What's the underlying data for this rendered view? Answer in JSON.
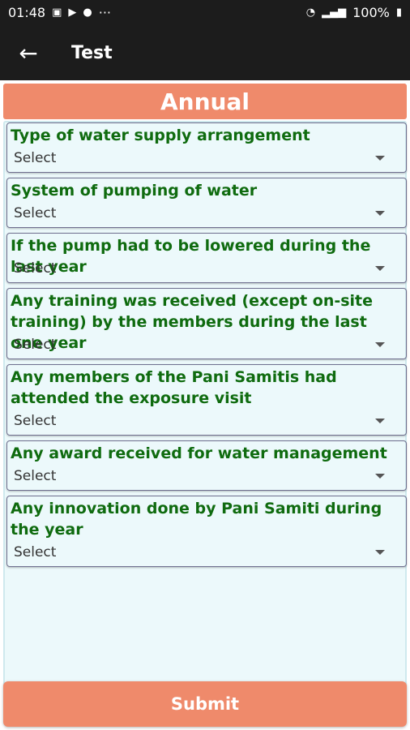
{
  "status_bar": {
    "time": "01:48",
    "battery": "100%",
    "more": "···"
  },
  "app_bar": {
    "back_icon": "arrow-left",
    "title": "Test"
  },
  "section": {
    "title": "Annual"
  },
  "fields": [
    {
      "label": "Type of water supply arrangement",
      "value": "Select"
    },
    {
      "label": "System of pumping of water",
      "value": "Select"
    },
    {
      "label": "If the pump had to be lowered during the last year",
      "value": "Select"
    },
    {
      "label": "Any training was received (except on-site training) by the members during the last one year",
      "value": "Select"
    },
    {
      "label": "Any members of the Pani Samitis had attended the exposure visit",
      "value": "Select"
    },
    {
      "label": "Any award received for water management",
      "value": "Select"
    },
    {
      "label": "Any innovation done by Pani Samiti during the year",
      "value": "Select"
    }
  ],
  "submit_label": "Submit",
  "colors": {
    "accent": "#ef8a6b",
    "label_green": "#0f6b0f",
    "bar_dark": "#1c1c1c",
    "form_bg": "#ecf9fb"
  }
}
